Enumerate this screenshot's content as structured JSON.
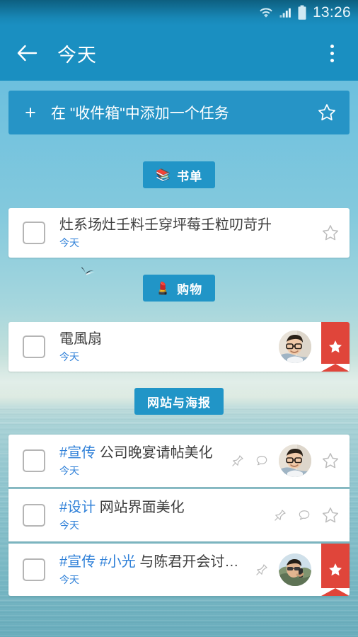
{
  "status_bar": {
    "time": "13:26",
    "icons": [
      "wifi-icon",
      "signal-icon",
      "battery-icon"
    ]
  },
  "app_bar": {
    "back_icon": "back-arrow-icon",
    "title": "今天",
    "overflow_icon": "overflow-menu-icon"
  },
  "add_bar": {
    "plus": "+",
    "label": "在 \"收件箱\"中添加一个任务",
    "star_icon": "star-outline-icon"
  },
  "colors": {
    "app_bar": "#1a8fc1",
    "add_bar": "#2694c6",
    "chip": "#2195c7",
    "accent_link": "#2f80d8",
    "ribbon_red": "#e0453a",
    "card_bg": "#ffffff",
    "title_text": "#3d3d3d"
  },
  "sections": [
    {
      "chip": {
        "label": "书单",
        "emoji": "📚",
        "emoji_name": "books-emoji"
      },
      "tasks": [
        {
          "checkbox_checked": false,
          "tags": [],
          "title": "灶系场灶壬料壬穿坪莓壬粒叨苛升",
          "date": "今天",
          "has_pin": false,
          "has_comment": false,
          "avatar": null,
          "starred": false,
          "star_icon": "star-outline-icon"
        }
      ]
    },
    {
      "chip": {
        "label": "购物",
        "emoji": "💄",
        "emoji_name": "lipstick-emoji"
      },
      "tasks": [
        {
          "checkbox_checked": false,
          "tags": [],
          "title": "電風扇",
          "date": "今天",
          "has_pin": false,
          "has_comment": false,
          "avatar": "avatar-man-glasses",
          "starred": true,
          "star_icon": "star-filled-icon"
        }
      ]
    },
    {
      "chip": {
        "label": "网站与海报",
        "emoji": "",
        "emoji_name": ""
      },
      "tasks": [
        {
          "checkbox_checked": false,
          "tags": [
            "#宣传"
          ],
          "title": "公司晚宴请帖美化",
          "date": "今天",
          "has_pin": true,
          "has_comment": true,
          "avatar": "avatar-man-glasses",
          "starred": false,
          "star_icon": "star-outline-icon"
        },
        {
          "checkbox_checked": false,
          "tags": [
            "#设计"
          ],
          "title": "网站界面美化",
          "date": "今天",
          "has_pin": true,
          "has_comment": true,
          "avatar": null,
          "starred": false,
          "star_icon": "star-outline-icon"
        },
        {
          "checkbox_checked": false,
          "tags": [
            "#宣传",
            "#小光"
          ],
          "title": "与陈君开会讨…",
          "date": "今天",
          "has_pin": true,
          "has_comment": false,
          "avatar": "avatar-man-phone",
          "starred": true,
          "star_icon": "star-filled-icon"
        }
      ]
    }
  ]
}
